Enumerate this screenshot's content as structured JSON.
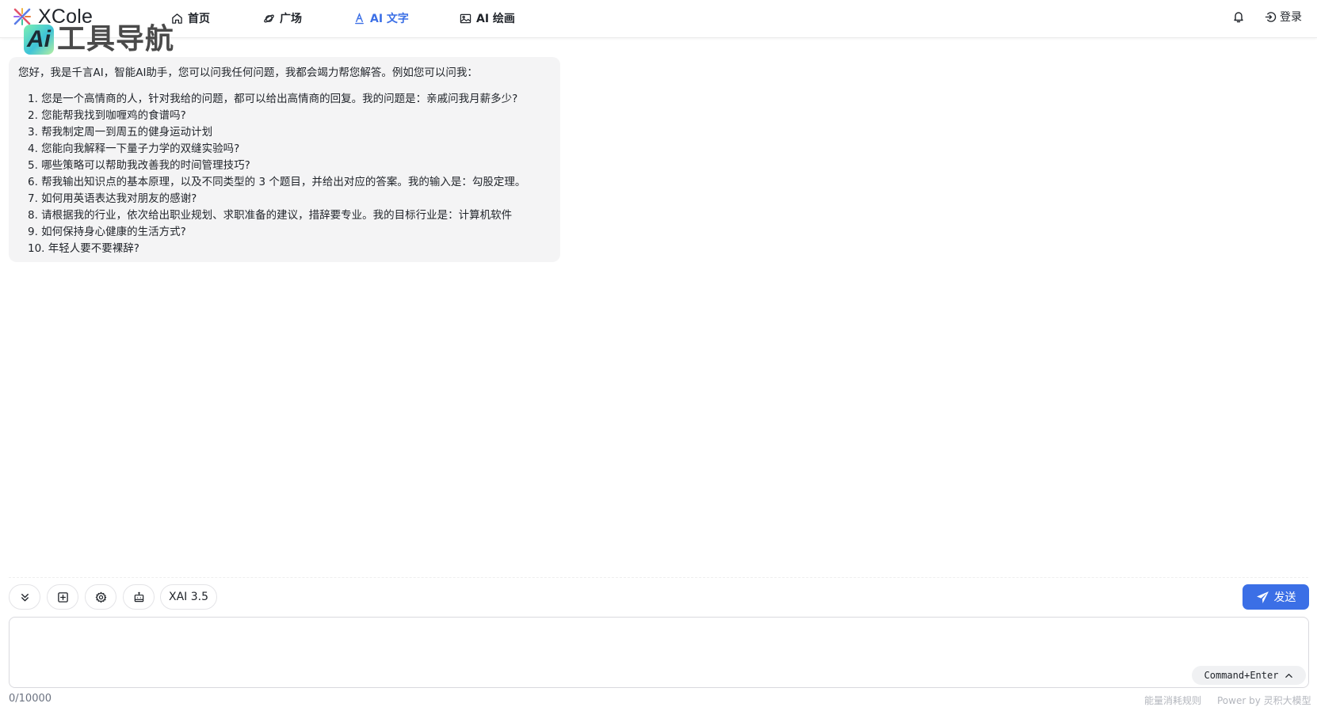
{
  "header": {
    "brand": "XCole",
    "watermark": {
      "badge": "Ai",
      "title": "工具导航",
      "url": "www.aidh.net"
    },
    "nav": [
      {
        "label": "首页",
        "icon": "home-icon"
      },
      {
        "label": "广场",
        "icon": "planet-icon"
      },
      {
        "label": "AI 文字",
        "icon": "text-a-icon",
        "active": true
      },
      {
        "label": "AI 绘画",
        "icon": "image-icon"
      }
    ],
    "login_label": "登录"
  },
  "chat": {
    "greeting": "您好，我是千言AI，智能AI助手，您可以问我任何问题，我都会竭力帮您解答。例如您可以问我：",
    "suggestions": [
      "1. 您是一个高情商的人，针对我给的问题，都可以给出高情商的回复。我的问题是：亲戚问我月薪多少?",
      "2. 您能帮我找到咖喱鸡的食谱吗?",
      "3. 帮我制定周一到周五的健身运动计划",
      "4. 您能向我解释一下量子力学的双缝实验吗?",
      "5. 哪些策略可以帮助我改善我的时间管理技巧?",
      "6. 帮我输出知识点的基本原理，以及不同类型的 3 个题目，并给出对应的答案。我的输入是：勾股定理。",
      "7. 如何用英语表达我对朋友的感谢?",
      "8. 请根据我的行业，依次给出职业规划、求职准备的建议，措辞要专业。我的目标行业是：计算机软件",
      "9. 如何保持身心健康的生活方式?",
      "10. 年轻人要不要裸辞?"
    ]
  },
  "composer": {
    "model_label": "XAI 3.5",
    "send_label": "发送",
    "input_value": "",
    "shortcut_label": "Command+Enter",
    "counter": "0/10000",
    "rules_link": "能量消耗规则",
    "power_by": "Power by 灵积大模型"
  },
  "colors": {
    "accent": "#3b6fe6",
    "bubble_bg": "#f4f4f5",
    "muted": "#b3b6bd"
  }
}
